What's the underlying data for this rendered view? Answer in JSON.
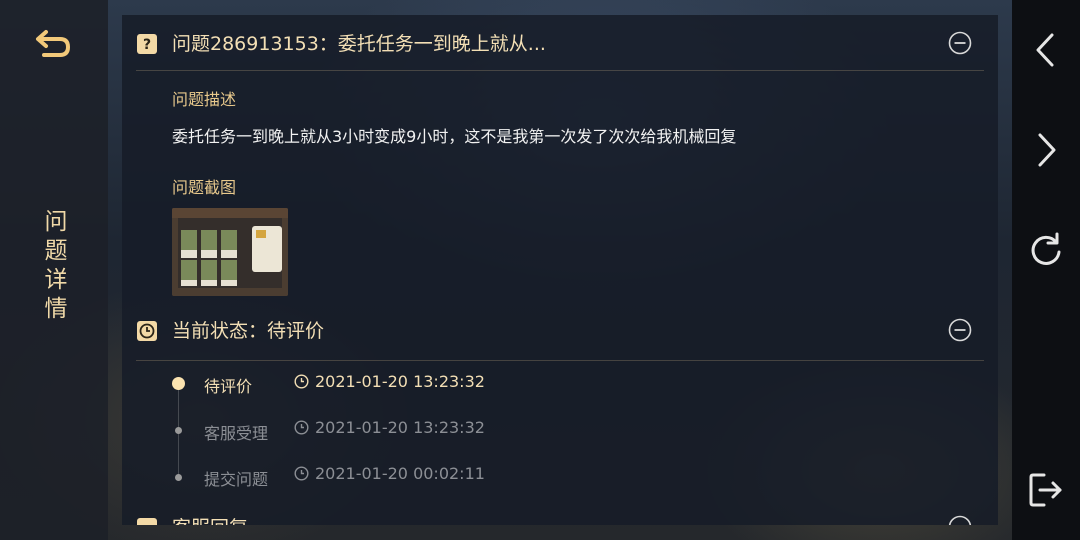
{
  "left_rail": {
    "back_icon": "return-arrow-icon",
    "title": "问题详情"
  },
  "right_rail": {
    "icons": [
      "chevron-left-icon",
      "chevron-right-icon",
      "refresh-icon",
      "exit-icon"
    ]
  },
  "issue": {
    "title": "问题286913153：委托任务一到晚上就从...",
    "description_label": "问题描述",
    "description": "委托任务一到晚上就从3小时变成9小时，这不是我第一次发了次次给我机械回复",
    "screenshot_label": "问题截图"
  },
  "status": {
    "title": "当前状态：待评价",
    "timeline": [
      {
        "label": "待评价",
        "time": "2021-01-20 13:23:32",
        "active": true
      },
      {
        "label": "客服受理",
        "time": "2021-01-20 13:23:32",
        "active": false
      },
      {
        "label": "提交问题",
        "time": "2021-01-20 00:02:11",
        "active": false
      }
    ]
  },
  "reply": {
    "title": "客服回复"
  },
  "colors": {
    "gold": "#e8c98c",
    "active_text": "#f3dfb5",
    "inactive_text": "#8c8f95"
  }
}
